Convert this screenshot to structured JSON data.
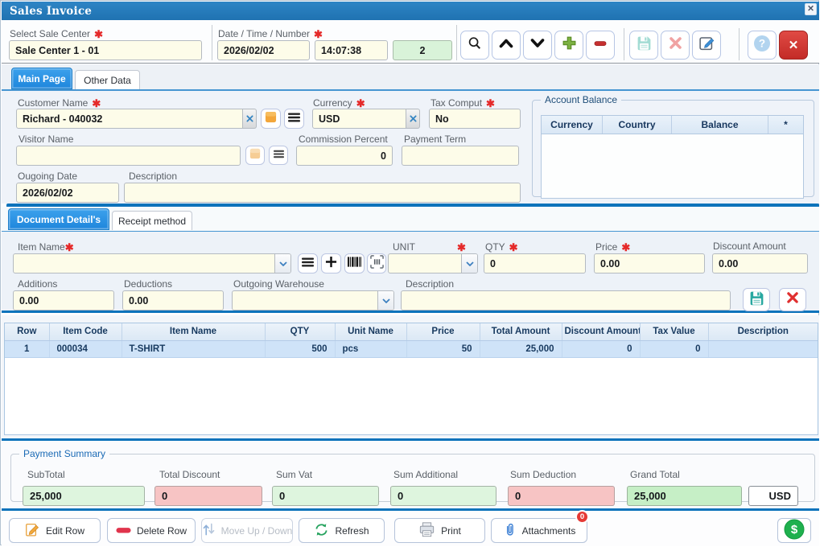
{
  "req": "✱",
  "window": {
    "title": "Sales Invoice",
    "close_icon": "✕"
  },
  "header": {
    "sale_center": {
      "label": "Select Sale Center",
      "value": "Sale Center 1 - 01"
    },
    "datetime": {
      "label": "Date / Time / Number",
      "date": "2026/02/02",
      "time": "14:07:38",
      "number": "2"
    }
  },
  "toolbar": {
    "icons": [
      "search",
      "move-up",
      "move-down",
      "add",
      "remove",
      "save",
      "delete",
      "edit",
      "help",
      "close"
    ],
    "close_icon": "✕"
  },
  "tabs_main": {
    "main_page": "Main Page",
    "other_data": "Other Data"
  },
  "form": {
    "customer_name": {
      "label": "Customer Name",
      "value": "Richard - 040032"
    },
    "currency": {
      "label": "Currency",
      "value": "USD"
    },
    "tax_comput": {
      "label": "Tax Comput",
      "value": "No"
    },
    "visitor_name": {
      "label": "Visitor Name",
      "value": ""
    },
    "commission_percent": {
      "label": "Commission Percent",
      "value": "0"
    },
    "payment_term": {
      "label": "Payment Term",
      "value": ""
    },
    "outgoing_date": {
      "label": "Ougoing Date",
      "value": "2026/02/02"
    },
    "description": {
      "label": "Description",
      "value": ""
    }
  },
  "account_balance": {
    "title": "Account Balance",
    "columns": [
      "Currency",
      "Country",
      "Balance",
      "*"
    ],
    "rows": []
  },
  "tabs_detail": {
    "document_details": "Document Detail's",
    "receipt_method": "Receipt method"
  },
  "entry": {
    "item_name_label": "Item Name",
    "unit_label": "UNIT",
    "qty": {
      "label": "QTY",
      "value": "0"
    },
    "price": {
      "label": "Price",
      "value": "0.00"
    },
    "discount_amount": {
      "label": "Discount Amount",
      "value": "0.00"
    },
    "additions": {
      "label": "Additions",
      "value": "0.00"
    },
    "deductions": {
      "label": "Deductions",
      "value": "0.00"
    },
    "outgoing_warehouse": {
      "label": "Outgoing Warehouse",
      "value": ""
    },
    "description": {
      "label": "Description",
      "value": ""
    }
  },
  "grid": {
    "columns": [
      "Row",
      "Item Code",
      "Item Name",
      "QTY",
      "Unit Name",
      "Price",
      "Total Amount",
      "Discount Amount",
      "Tax Value",
      "Description"
    ],
    "rows": [
      [
        "1",
        "000034",
        "T-SHIRT",
        "500",
        "pcs",
        "50",
        "25,000",
        "0",
        "0",
        ""
      ]
    ]
  },
  "summary": {
    "title": "Payment Summary",
    "subtotal": {
      "label": "SubTotal",
      "value": "25,000"
    },
    "total_discount": {
      "label": "Total Discount",
      "value": "0"
    },
    "sum_vat": {
      "label": "Sum Vat",
      "value": "0"
    },
    "sum_additional": {
      "label": "Sum Additional",
      "value": "0"
    },
    "sum_deduction": {
      "label": "Sum Deduction",
      "value": "0"
    },
    "grand_total": {
      "label": "Grand Total",
      "value": "25,000"
    },
    "currency": "USD"
  },
  "footer": {
    "edit_row": "Edit Row",
    "delete_row": "Delete Row",
    "move_up_down": "Move Up / Down",
    "refresh": "Refresh",
    "print": "Print",
    "attachments": "Attachments",
    "attachments_badge": "0"
  }
}
